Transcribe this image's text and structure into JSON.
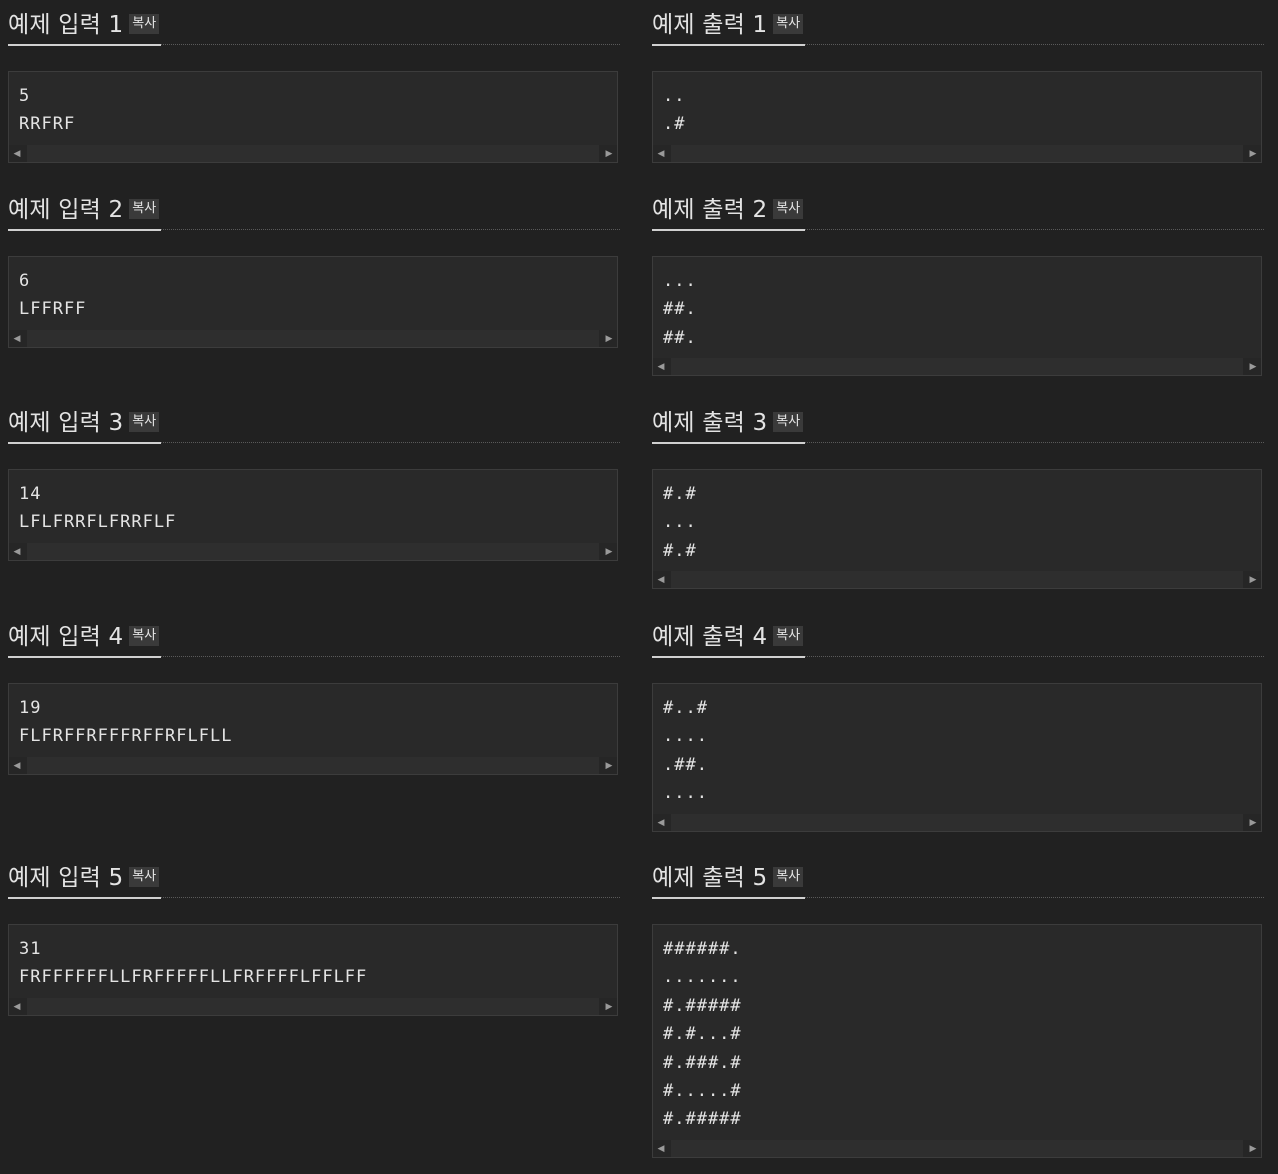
{
  "copy_label": "복사",
  "inputs": [
    {
      "title": "예제 입력 1",
      "lines": [
        "5",
        "RRFRF"
      ]
    },
    {
      "title": "예제 입력 2",
      "lines": [
        "6",
        "LFFRFF"
      ]
    },
    {
      "title": "예제 입력 3",
      "lines": [
        "14",
        "LFLFRRFLFRRFLF"
      ]
    },
    {
      "title": "예제 입력 4",
      "lines": [
        "19",
        "FLFRFFRFFFRFFRFLFLL"
      ]
    },
    {
      "title": "예제 입력 5",
      "lines": [
        "31",
        "FRFFFFFFLLFRFFFFFLLFRFFFFLFFLFF"
      ]
    }
  ],
  "outputs": [
    {
      "title": "예제 출력 1",
      "lines": [
        "..",
        ".#"
      ]
    },
    {
      "title": "예제 출력 2",
      "lines": [
        "...",
        "##.",
        "##."
      ]
    },
    {
      "title": "예제 출력 3",
      "lines": [
        "#.#",
        "...",
        "#.#"
      ]
    },
    {
      "title": "예제 출력 4",
      "lines": [
        "#..#",
        "....",
        ".##.",
        "...."
      ]
    },
    {
      "title": "예제 출력 5",
      "lines": [
        "######.",
        ".......",
        "#.#####",
        "#.#...#",
        "#.###.#",
        "#.....#",
        "#.#####"
      ]
    }
  ]
}
